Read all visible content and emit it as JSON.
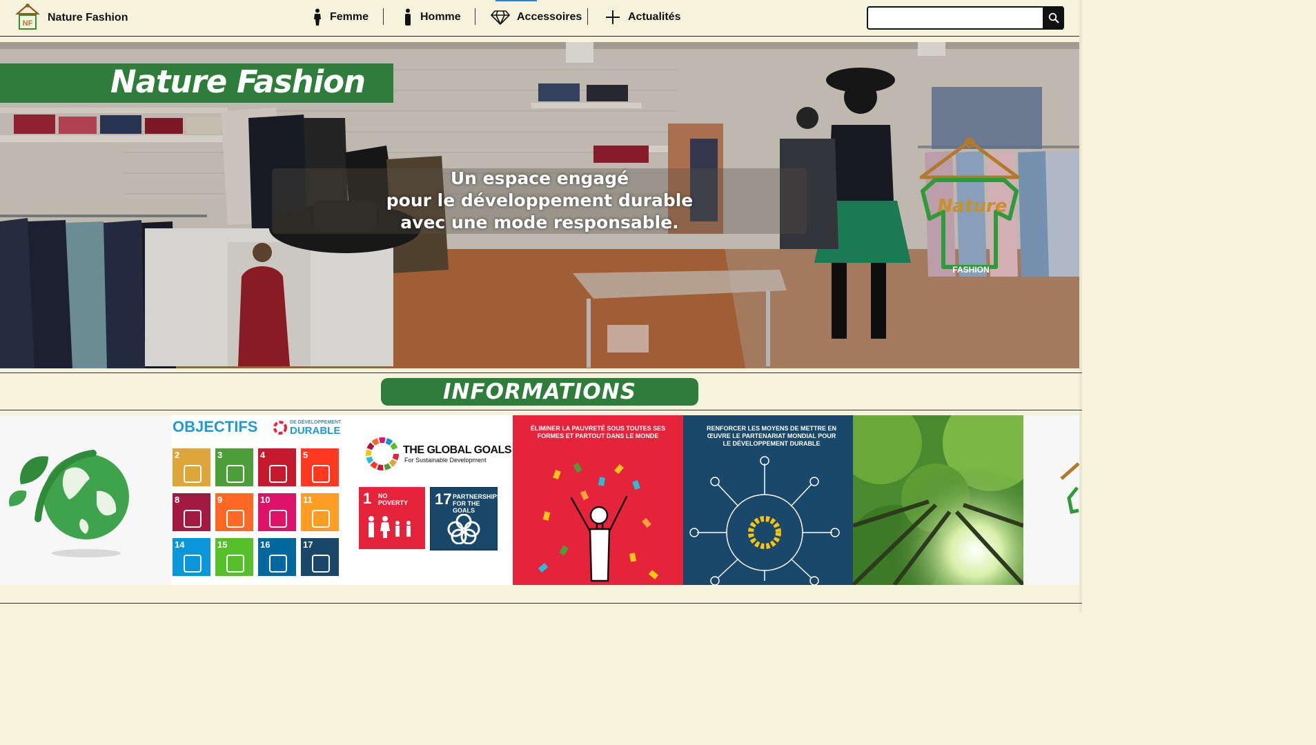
{
  "navbar": {
    "brand": "Nature Fashion",
    "logo_text": "NF",
    "links": [
      {
        "label": "Femme",
        "icon": "woman-icon"
      },
      {
        "label": "Homme",
        "icon": "man-icon"
      },
      {
        "label": "Accessoires",
        "icon": "diamond-icon"
      },
      {
        "label": "Actualités",
        "icon": "plus-icon"
      }
    ],
    "search": {
      "value": "",
      "placeholder": ""
    }
  },
  "hero": {
    "banner_title": "Nature Fashion",
    "tagline": [
      "Un espace engagé",
      "pour le développement durable",
      "avec une mode responsable."
    ],
    "watermark_logo": {
      "line1": "Nature",
      "line2": "FASHION"
    }
  },
  "informations": {
    "title": "INFORMATIONS"
  },
  "cards": {
    "sdg_card": {
      "heading": "OBJECTIFS",
      "sub1": "DE DÉVELOPPEMENT",
      "sub2": "DURABLE",
      "tiles": [
        {
          "num": "2",
          "color": "#dda63a"
        },
        {
          "num": "3",
          "color": "#4c9f38"
        },
        {
          "num": "4",
          "color": "#c5192d"
        },
        {
          "num": "5",
          "color": "#ff3a21"
        },
        {
          "num": "8",
          "color": "#a21942"
        },
        {
          "num": "9",
          "color": "#fd6925"
        },
        {
          "num": "10",
          "color": "#dd1367"
        },
        {
          "num": "11",
          "color": "#fd9d24"
        },
        {
          "num": "14",
          "color": "#0a97d9"
        },
        {
          "num": "15",
          "color": "#56c02b"
        },
        {
          "num": "16",
          "color": "#00689d"
        },
        {
          "num": "17",
          "color": "#19486a"
        }
      ]
    },
    "global_goals": {
      "title": "THE GLOBAL GOALS",
      "subtitle": "For Sustainable Development",
      "goal1": {
        "num": "1",
        "label": "NO POVERTY",
        "color": "#e5243b"
      },
      "goal17": {
        "num": "17",
        "label": "PARTNERSHIPS FOR THE GOALS",
        "color": "#19486a"
      }
    },
    "poster_poverty": {
      "text": "ÉLIMINER LA PAUVRETÉ SOUS TOUTES SES FORMES ET PARTOUT DANS LE MONDE"
    },
    "poster_partnership": {
      "text": "RENFORCER LES MOYENS DE METTRE EN ŒUVRE LE PARTENARIAT MONDIAL POUR LE DÉVELOPPEMENT DURABLE"
    }
  }
}
